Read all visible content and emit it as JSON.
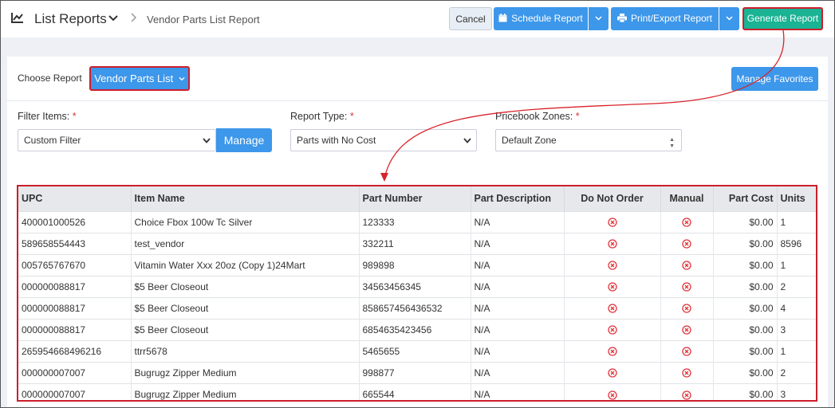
{
  "header": {
    "title": "List Reports",
    "breadcrumb": "Vendor Parts List Report",
    "cancel_label": "Cancel",
    "schedule_label": "Schedule Report",
    "print_label": "Print/Export Report",
    "generate_label": "Generate Report"
  },
  "report": {
    "choose_label": "Choose Report",
    "selected": "Vendor Parts List",
    "manage_favorites_label": "Manage Favorites"
  },
  "filters": {
    "filter_items_label": "Filter Items:",
    "filter_items_value": "Custom Filter",
    "manage_label": "Manage",
    "report_type_label": "Report Type:",
    "report_type_value": "Parts with No Cost",
    "pricebook_label": "Pricebook Zones:",
    "pricebook_value": "Default Zone",
    "required_mark": "*"
  },
  "table": {
    "columns": [
      "UPC",
      "Item Name",
      "Part Number",
      "Part Description",
      "Do Not Order",
      "Manual",
      "Part Cost",
      "Units"
    ],
    "rows": [
      {
        "upc": "400001000526",
        "item": "Choice Fbox 100w Tc Silver",
        "part": "123333",
        "desc": "N/A",
        "cost": "$0.00",
        "units": "1"
      },
      {
        "upc": "589658554443",
        "item": "test_vendor",
        "part": "332211",
        "desc": "N/A",
        "cost": "$0.00",
        "units": "8596"
      },
      {
        "upc": "005765767670",
        "item": "Vitamin Water Xxx 20oz (Copy 1)24Mart",
        "part": "989898",
        "desc": "N/A",
        "cost": "$0.00",
        "units": "1"
      },
      {
        "upc": "000000088817",
        "item": "$5 Beer Closeout",
        "part": "34563456345",
        "desc": "N/A",
        "cost": "$0.00",
        "units": "2"
      },
      {
        "upc": "000000088817",
        "item": "$5 Beer Closeout",
        "part": "858657456436532",
        "desc": "N/A",
        "cost": "$0.00",
        "units": "4"
      },
      {
        "upc": "000000088817",
        "item": "$5 Beer Closeout",
        "part": "6854635423456",
        "desc": "N/A",
        "cost": "$0.00",
        "units": "3"
      },
      {
        "upc": "265954668496216",
        "item": "ttrr5678",
        "part": "5465655",
        "desc": "N/A",
        "cost": "$0.00",
        "units": "1"
      },
      {
        "upc": "000000007007",
        "item": "Bugrugz Zipper Medium",
        "part": "998877",
        "desc": "N/A",
        "cost": "$0.00",
        "units": "2"
      },
      {
        "upc": "000000007007",
        "item": "Bugrugz Zipper Medium",
        "part": "665544",
        "desc": "N/A",
        "cost": "$0.00",
        "units": "3"
      }
    ]
  },
  "colors": {
    "primary": "#3d97ea",
    "generate": "#1ab394",
    "highlight": "#cc1f2b",
    "x_icon": "#e0343b"
  },
  "icons": {
    "title": "line-chart-icon",
    "schedule": "calendar-icon",
    "print": "printer-icon",
    "status": "x-circle-icon"
  }
}
